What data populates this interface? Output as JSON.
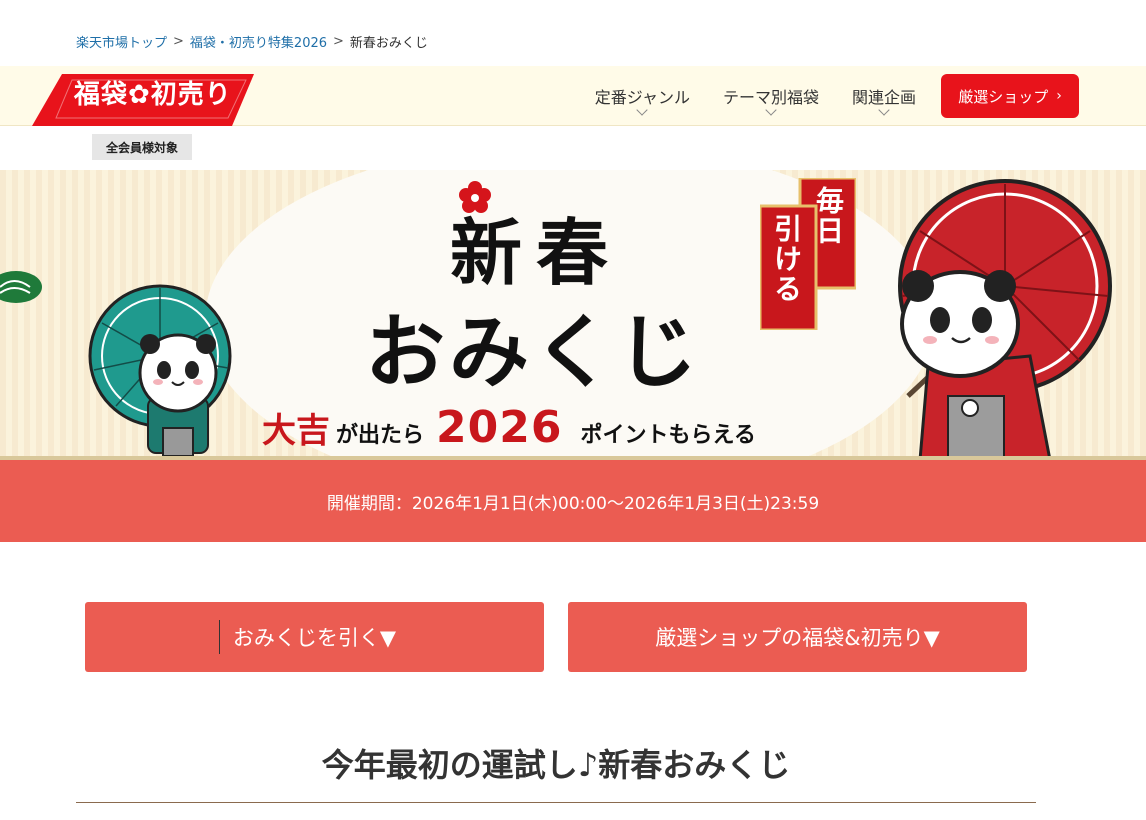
{
  "breadcrumb": {
    "items": [
      "楽天市場トップ",
      "福袋・初売り特集2026"
    ],
    "current": "新春おみくじ",
    "separator": ">"
  },
  "header": {
    "logo_text": "福袋✿初売り",
    "nav": [
      {
        "label": "定番ジャンル",
        "icon": "chevron-down-icon"
      },
      {
        "label": "テーマ別福袋",
        "icon": "chevron-down-icon"
      },
      {
        "label": "関連企画",
        "icon": "chevron-down-icon"
      }
    ],
    "shop_button": {
      "label": "厳選ショップ",
      "arrow": "›"
    }
  },
  "member_badge": "全会員様対象",
  "hero": {
    "title_line1": "新春",
    "title_line2": "おみくじ",
    "daily_col1": "毎日",
    "daily_col2": "引ける",
    "sub_daikichi": "大吉",
    "sub_mid": "が出たら",
    "sub_year": "2026",
    "sub_end": "ポイントもらえる"
  },
  "period": {
    "text": "開催期間：2026年1月1日(木)00:00～2026年1月3日(土)23:59"
  },
  "actions": {
    "draw_label": "おみくじを引く▼",
    "shops_label": "厳選ショップの福袋&初売り▼"
  },
  "section": {
    "title": "今年最初の運試し♪新春おみくじ"
  },
  "colors": {
    "brand_red": "#e8131b",
    "banner_coral": "#eb5c52",
    "header_bg": "#fffbe8",
    "link_blue": "#1f6fa8"
  }
}
